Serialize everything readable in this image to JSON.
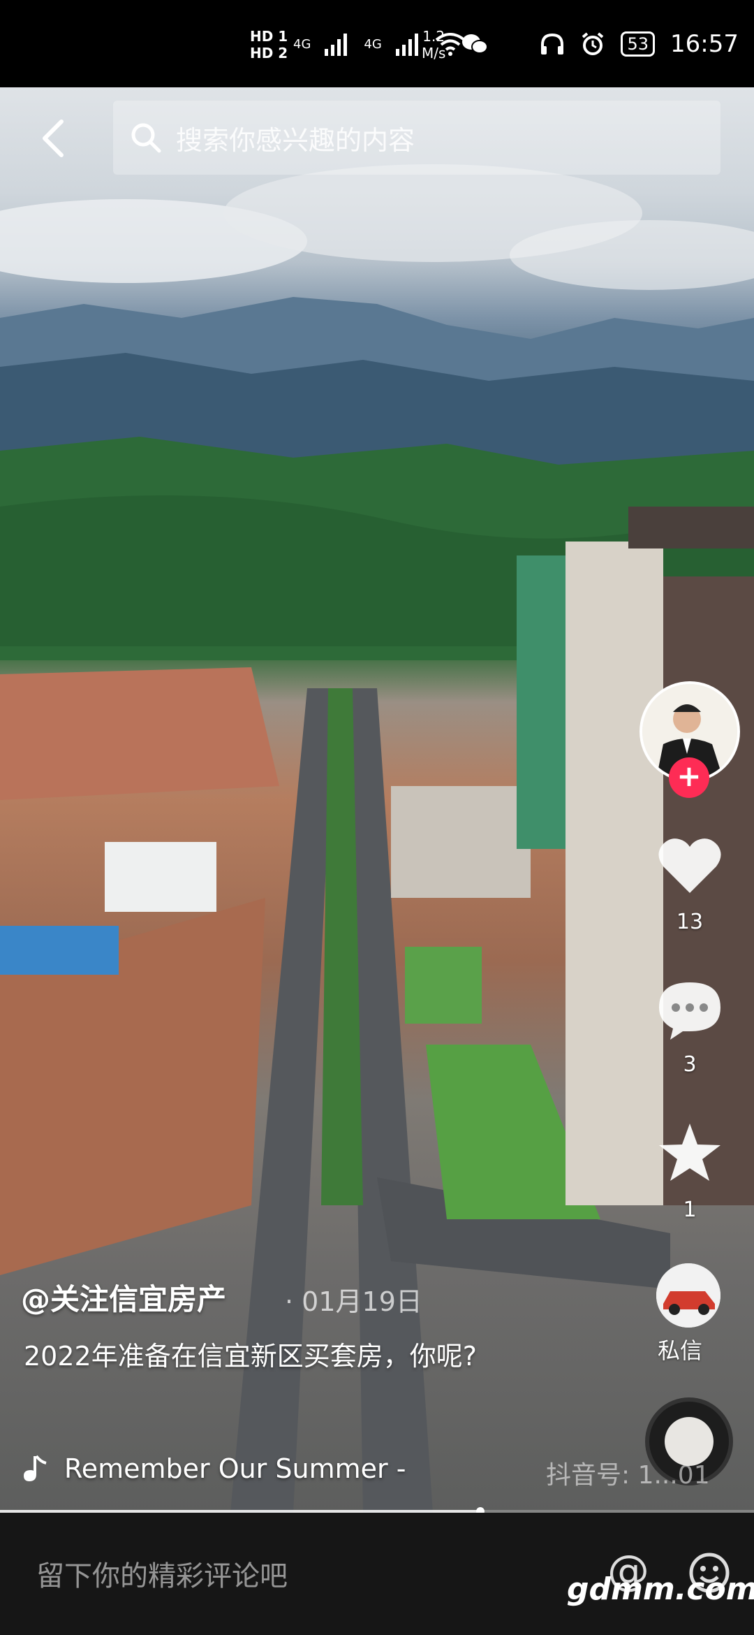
{
  "status_bar": {
    "hd1": "HD 1",
    "hd2": "HD 2",
    "net1": "4G",
    "net2": "4G",
    "speed_value": "1.2",
    "speed_unit": "M/s",
    "battery": "53",
    "time": "16:57"
  },
  "search": {
    "placeholder": "搜索你感兴趣的内容"
  },
  "right_rail": {
    "like_count": "13",
    "comment_count": "3",
    "favorite_count": "1",
    "dm_label": "私信"
  },
  "video_overlay": {
    "author": "@关注信宜房产",
    "date": "· 01月19日",
    "description": "2022年准备在信宜新区买套房，你呢?",
    "music": "Remember Our Summer -",
    "watermark": "抖音号: 1...01"
  },
  "progress": {
    "played_fraction": 0.637
  },
  "bottom_bar": {
    "comment_placeholder": "留下你的精彩评论吧",
    "at_symbol": "@",
    "site_watermark": "gdmm.com"
  },
  "colors": {
    "follow": "#fe2c55",
    "bottom_bg": "#161616"
  }
}
